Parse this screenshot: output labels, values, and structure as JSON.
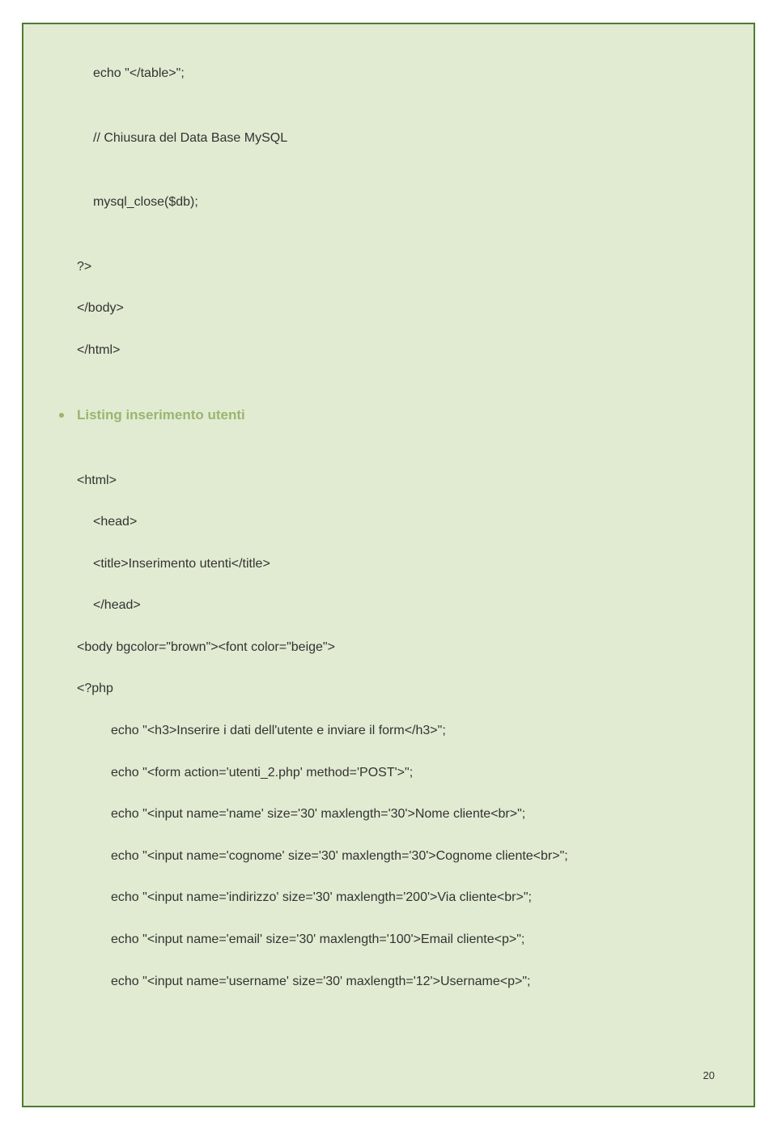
{
  "lines": {
    "l1": "echo \"</table>\";",
    "l2": "// Chiusura del Data Base MySQL",
    "l3": "mysql_close($db);",
    "l4": "?>",
    "l5": "</body>",
    "l6": "</html>"
  },
  "bullet": {
    "text": "Listing inserimento utenti"
  },
  "lines2": {
    "l7": "<html>",
    "l8": "<head>",
    "l9": "<title>Inserimento utenti</title>",
    "l10": "</head>",
    "l11": "<body bgcolor=\"brown\"><font color=\"beige\">",
    "l12": "<?php",
    "l13": "echo \"<h3>Inserire i dati dell'utente e inviare il form</h3>\";",
    "l14": "echo \"<form action='utenti_2.php' method='POST'>\";",
    "l15": "echo \"<input name='name' size='30' maxlength='30'>Nome cliente<br>\";",
    "l16": "echo \"<input name='cognome' size='30' maxlength='30'>Cognome cliente<br>\";",
    "l17": "echo \"<input name='indirizzo' size='30' maxlength='200'>Via cliente<br>\";",
    "l18": "echo \"<input name='email' size='30' maxlength='100'>Email cliente<p>\";",
    "l19": "echo \"<input name='username' size='30' maxlength='12'>Username<p>\";"
  },
  "page_number": "20"
}
